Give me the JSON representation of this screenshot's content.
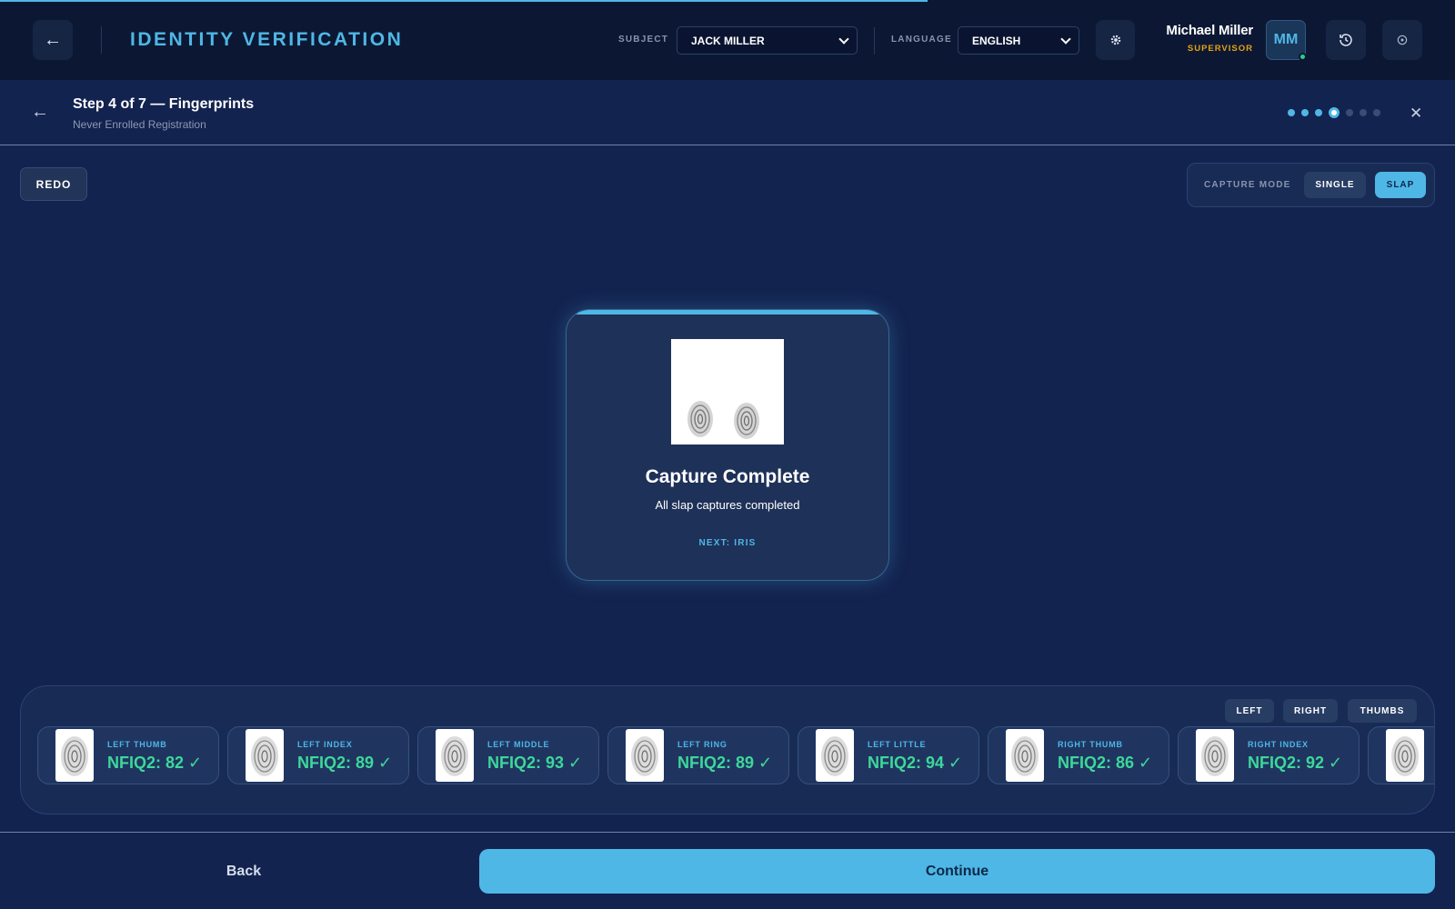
{
  "header": {
    "title": "IDENTITY VERIFICATION",
    "subject_label": "SUBJECT",
    "subject_value": "JACK MILLER",
    "language_label": "LANGUAGE",
    "language_value": "ENGLISH",
    "user_name": "Michael Miller",
    "user_role": "SUPERVISOR",
    "avatar_initials": "MM"
  },
  "step": {
    "title": "Step 4 of 7 — Fingerprints",
    "subtitle": "Never Enrolled Registration",
    "current": 4,
    "total": 7
  },
  "toolbar": {
    "redo_label": "REDO",
    "capture_mode_label": "CAPTURE MODE",
    "modes": [
      "SINGLE",
      "SLAP"
    ],
    "active_mode": "SLAP"
  },
  "capture": {
    "title": "Capture Complete",
    "subtitle": "All slap captures completed",
    "next_label": "NEXT: IRIS"
  },
  "filters": [
    "LEFT",
    "RIGHT",
    "THUMBS"
  ],
  "fingers": [
    {
      "name": "LEFT THUMB",
      "score": "NFIQ2: 82 ✓"
    },
    {
      "name": "LEFT INDEX",
      "score": "NFIQ2: 89 ✓"
    },
    {
      "name": "LEFT MIDDLE",
      "score": "NFIQ2: 93 ✓"
    },
    {
      "name": "LEFT RING",
      "score": "NFIQ2: 89 ✓"
    },
    {
      "name": "LEFT LITTLE",
      "score": "NFIQ2: 94 ✓"
    },
    {
      "name": "RIGHT THUMB",
      "score": "NFIQ2: 86 ✓"
    },
    {
      "name": "RIGHT INDEX",
      "score": "NFIQ2: 92 ✓"
    }
  ],
  "footer": {
    "back_label": "Back",
    "continue_label": "Continue"
  },
  "colors": {
    "accent": "#4fb7e6",
    "success": "#3ed79a",
    "supervisor": "#e6a117",
    "background": "#13234f"
  },
  "icons": [
    "arrow-left-icon",
    "gear-icon",
    "history-icon",
    "power-icon",
    "close-icon",
    "chevron-down-icon",
    "fingerprint-icon"
  ]
}
